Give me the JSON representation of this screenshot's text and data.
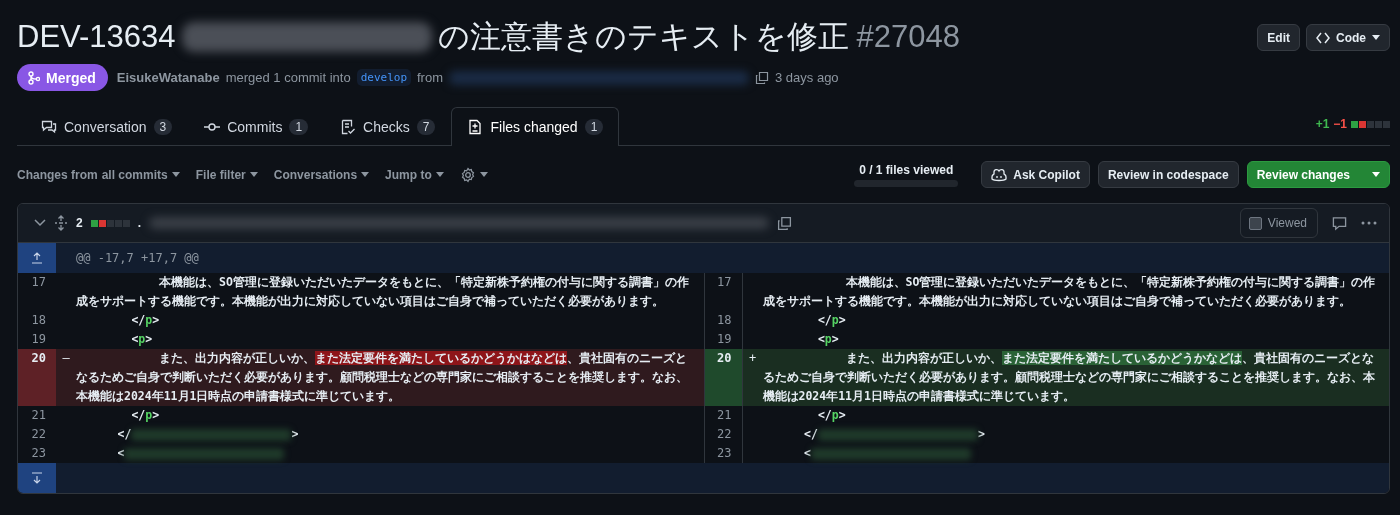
{
  "header": {
    "title_prefix": "DEV-13634",
    "title_suffix": "の注意書きのテキストを修正",
    "number": "#27048",
    "buttons": [
      {
        "label": "Edit",
        "kind": "plain"
      },
      {
        "label": "Code",
        "kind": "code"
      }
    ]
  },
  "meta": {
    "state": "Merged",
    "author": "EisukeWatanabe",
    "action": "merged 1 commit into",
    "base_branch": "develop",
    "from": "from",
    "time": "3 days ago"
  },
  "tabs": [
    {
      "label": "Conversation",
      "count": "3",
      "kind": "conversation",
      "selected": false
    },
    {
      "label": "Commits",
      "count": "1",
      "kind": "commits",
      "selected": false
    },
    {
      "label": "Checks",
      "count": "7",
      "kind": "checks",
      "selected": false
    },
    {
      "label": "Files changed",
      "count": "1",
      "kind": "files",
      "selected": true
    }
  ],
  "diffstat": {
    "added": "+1",
    "removed": "−1"
  },
  "toolbar": {
    "changes_from": "Changes from **all commits**",
    "filters": [
      "File filter",
      "Conversations",
      "Jump to"
    ],
    "files_viewed": "0 / 1 files viewed",
    "progress": {
      "level": 0
    },
    "buttons": [
      {
        "label": "Ask Copilot",
        "kind": "copilot"
      },
      {
        "label": "Review in codespace",
        "kind": "plain"
      },
      {
        "label": "Review changes",
        "kind": "primary"
      }
    ]
  },
  "file": {
    "changes": "2",
    "path_start": ".",
    "viewed_label": "Viewed",
    "viewed": false,
    "expanded": true
  },
  "hunk": "@@ -17,7 +17,7 @@",
  "rows": [
    {
      "left": {
        "num": "17",
        "kind": "context",
        "tokens": [
          {
            "kind": "plain",
            "text": "            本機能は、SO管理に登録いただいたデータをもとに、「特定新株予約権の付与に関する調書」の作成をサポートする機能です。本機能が出力に対応していない項目はご自身で補っていただく必要があります。"
          }
        ]
      },
      "right": {
        "num": "17",
        "kind": "context",
        "tokens": [
          {
            "kind": "plain",
            "text": "            本機能は、SO管理に登録いただいたデータをもとに、「特定新株予約権の付与に関する調書」の作成をサポートする機能です。本機能が出力に対応していない項目はご自身で補っていただく必要があります。"
          }
        ]
      }
    },
    {
      "left": {
        "num": "18",
        "kind": "context",
        "tokens": [
          {
            "kind": "plain",
            "text": "        </"
          },
          {
            "kind": "tag",
            "text": "p"
          },
          {
            "kind": "plain",
            "text": ">"
          }
        ]
      },
      "right": {
        "num": "18",
        "kind": "context",
        "tokens": [
          {
            "kind": "plain",
            "text": "        </"
          },
          {
            "kind": "tag",
            "text": "p"
          },
          {
            "kind": "plain",
            "text": ">"
          }
        ]
      }
    },
    {
      "left": {
        "num": "19",
        "kind": "context",
        "tokens": [
          {
            "kind": "plain",
            "text": "        <"
          },
          {
            "kind": "tag",
            "text": "p"
          },
          {
            "kind": "plain",
            "text": ">"
          }
        ]
      },
      "right": {
        "num": "19",
        "kind": "context",
        "tokens": [
          {
            "kind": "plain",
            "text": "        <"
          },
          {
            "kind": "tag",
            "text": "p"
          },
          {
            "kind": "plain",
            "text": ">"
          }
        ]
      }
    },
    {
      "left": {
        "num": "20",
        "kind": "deletion",
        "sign": "–",
        "tokens": [
          {
            "kind": "plain",
            "text": "            また、出力内容が正しいか、"
          },
          {
            "kind": "highlight",
            "text": "また法定要件を満たしているかどうかはなどは"
          },
          {
            "kind": "plain",
            "text": "、貴社固有のニーズとなるためご自身で判断いただく必要があります。顧問税理士などの専門家にご相談することを推奨します。なお、本機能は2024年11月1日時点の申請書様式に準じています。"
          }
        ]
      },
      "right": {
        "num": "20",
        "kind": "addition",
        "sign": "+",
        "tokens": [
          {
            "kind": "plain",
            "text": "            また、出力内容が正しいか、"
          },
          {
            "kind": "highlight",
            "text": "また法定要件を満たしているかどうかなどは"
          },
          {
            "kind": "plain",
            "text": "、貴社固有のニーズとなるためご自身で判断いただく必要があります。顧問税理士などの専門家にご相談することを推奨します。なお、本機能は2024年11月1日時点の申請書様式に準じています。"
          }
        ]
      }
    },
    {
      "left": {
        "num": "21",
        "kind": "context",
        "tokens": [
          {
            "kind": "plain",
            "text": "        </"
          },
          {
            "kind": "tag",
            "text": "p"
          },
          {
            "kind": "plain",
            "text": ">"
          }
        ]
      },
      "right": {
        "num": "21",
        "kind": "context",
        "tokens": [
          {
            "kind": "plain",
            "text": "        </"
          },
          {
            "kind": "tag",
            "text": "p"
          },
          {
            "kind": "plain",
            "text": ">"
          }
        ]
      }
    },
    {
      "left": {
        "num": "22",
        "kind": "context",
        "tokens": [
          {
            "kind": "plain",
            "text": "      </"
          },
          {
            "kind": "blur"
          },
          {
            "kind": "plain",
            "text": ">"
          }
        ]
      },
      "right": {
        "num": "22",
        "kind": "context",
        "tokens": [
          {
            "kind": "plain",
            "text": "      </"
          },
          {
            "kind": "blur"
          },
          {
            "kind": "plain",
            "text": ">"
          }
        ]
      }
    },
    {
      "left": {
        "num": "23",
        "kind": "context",
        "tokens": [
          {
            "kind": "plain",
            "text": "      <"
          },
          {
            "kind": "blur"
          }
        ]
      },
      "right": {
        "num": "23",
        "kind": "context",
        "tokens": [
          {
            "kind": "plain",
            "text": "      <"
          },
          {
            "kind": "blur"
          }
        ]
      }
    }
  ]
}
